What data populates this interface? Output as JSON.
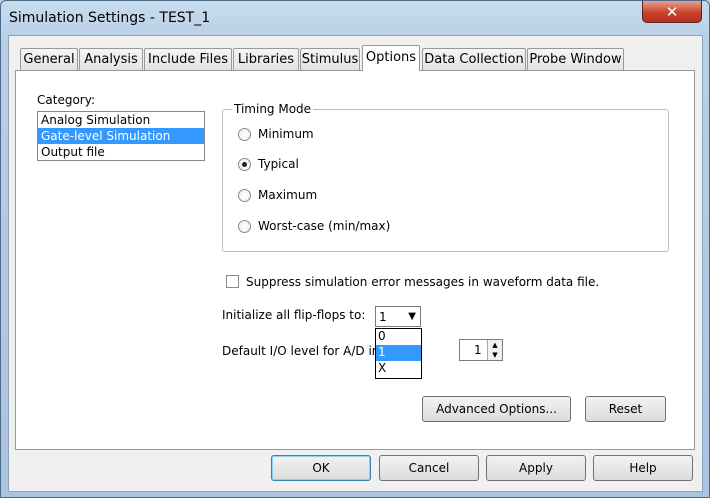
{
  "window": {
    "title": "Simulation Settings - TEST_1",
    "close_glyph": "✕"
  },
  "tabs": [
    {
      "label": "General"
    },
    {
      "label": "Analysis"
    },
    {
      "label": "Include Files"
    },
    {
      "label": "Libraries"
    },
    {
      "label": "Stimulus"
    },
    {
      "label": "Options",
      "active": true
    },
    {
      "label": "Data Collection"
    },
    {
      "label": "Probe Window"
    }
  ],
  "category": {
    "label": "Category:",
    "items": [
      "Analog Simulation",
      "Gate-level Simulation",
      "Output file"
    ],
    "selected": "Gate-level Simulation"
  },
  "timing_mode": {
    "legend": "Timing Mode",
    "options": [
      "Minimum",
      "Typical",
      "Maximum",
      "Worst-case (min/max)"
    ],
    "selected": "Typical"
  },
  "suppress": {
    "label": "Suppress simulation error messages in waveform data file.",
    "checked": false
  },
  "init_flipflops": {
    "label": "Initialize all flip-flops to:",
    "value": "1",
    "options": [
      "0",
      "1",
      "X"
    ],
    "highlighted": "1"
  },
  "default_io": {
    "label": "Default I/O level for A/D in",
    "value": "1"
  },
  "buttons": {
    "advanced": "Advanced Options...",
    "reset": "Reset",
    "ok": "OK",
    "cancel": "Cancel",
    "apply": "Apply",
    "help": "Help"
  },
  "icons": {
    "dropdown_arrow": "▼",
    "spin_up": "▲",
    "spin_down": "▼"
  }
}
